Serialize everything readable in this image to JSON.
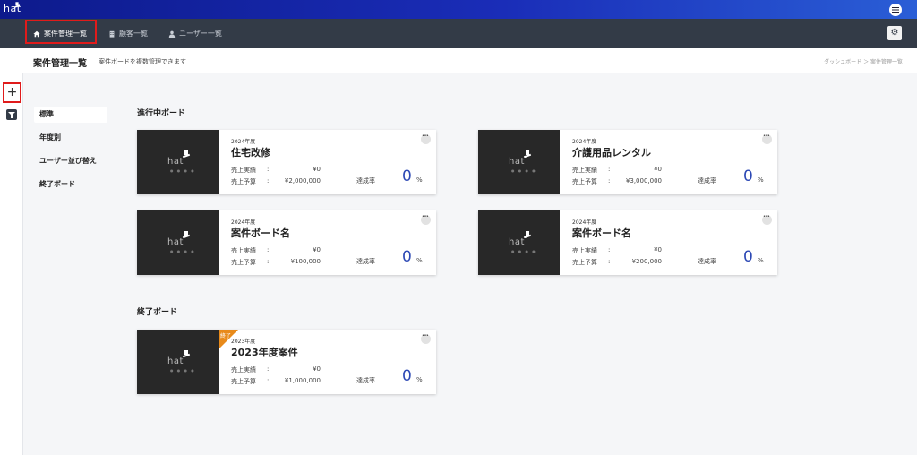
{
  "app": {
    "logo_text": "hat"
  },
  "nav": {
    "items": [
      {
        "label": "案件管理一覧",
        "icon": "home-icon"
      },
      {
        "label": "顧客一覧",
        "icon": "building-icon"
      },
      {
        "label": "ユーザー一覧",
        "icon": "user-icon"
      }
    ]
  },
  "header": {
    "title": "案件管理一覧",
    "subtitle": "案件ボードを複数管理できます",
    "breadcrumb": "ダッシュボード ＞ 案件管理一覧"
  },
  "toolbar": {
    "add_label": "+"
  },
  "sort_menu": {
    "items": [
      {
        "label": "標準"
      },
      {
        "label": "年度別"
      },
      {
        "label": "ユーザー並び替え"
      },
      {
        "label": "終了ボード"
      }
    ]
  },
  "sections": {
    "active_title": "進行中ボード",
    "closed_title": "終了ボード"
  },
  "card_labels": {
    "sales_actual": "売上実績",
    "sales_budget": "売上予算",
    "colon": ":",
    "rate": "達成率",
    "pct": "%",
    "thumb_text": "hat",
    "thumb_dots": "● ● ● ●",
    "closed_ribbon": "終了"
  },
  "boards": [
    {
      "year": "2024年度",
      "name": "住宅改修",
      "actual": "¥0",
      "budget": "¥2,000,000",
      "rate": "0"
    },
    {
      "year": "2024年度",
      "name": "介護用品レンタル",
      "actual": "¥0",
      "budget": "¥3,000,000",
      "rate": "0"
    },
    {
      "year": "2024年度",
      "name": "案件ボード名",
      "actual": "¥0",
      "budget": "¥100,000",
      "rate": "0"
    },
    {
      "year": "2024年度",
      "name": "案件ボード名",
      "actual": "¥0",
      "budget": "¥200,000",
      "rate": "0"
    }
  ],
  "closed_boards": [
    {
      "year": "2023年度",
      "name": "2023年度案件",
      "actual": "¥0",
      "budget": "¥1,000,000",
      "rate": "0"
    }
  ],
  "colors": {
    "accent": "#2d49b5",
    "nav_bg": "#333b47",
    "highlight": "#e01b1b",
    "ribbon": "#e88a1a"
  }
}
